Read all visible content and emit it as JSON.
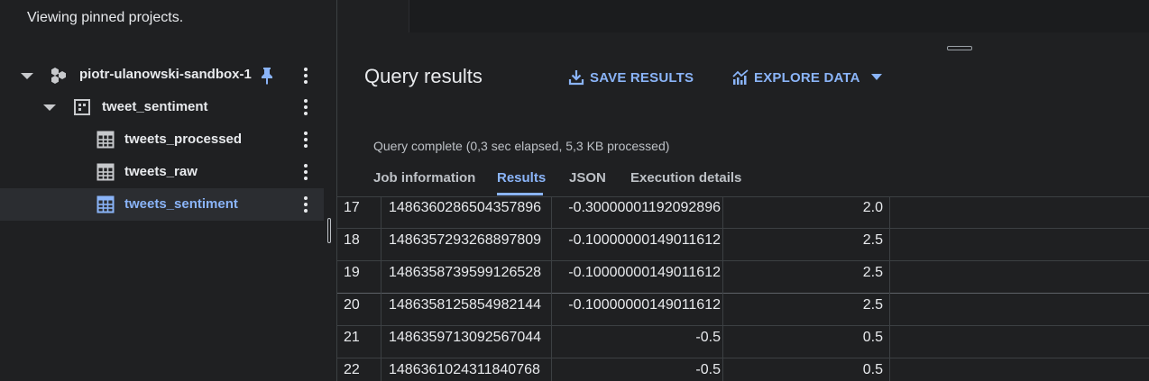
{
  "explorer": {
    "pinned_note": "Viewing pinned projects.",
    "project": {
      "label": "piotr-ulanowski-sandbox-1",
      "icon": "project-hexagons-icon",
      "pinned": true
    },
    "dataset": {
      "label": "tweet_sentiment",
      "icon": "dataset-icon"
    },
    "tables": [
      {
        "label": "tweets_processed",
        "icon": "table-icon",
        "selected": false
      },
      {
        "label": "tweets_raw",
        "icon": "table-icon",
        "selected": false
      },
      {
        "label": "tweets_sentiment",
        "icon": "table-icon",
        "selected": true
      }
    ]
  },
  "results": {
    "title": "Query results",
    "save_label": "SAVE RESULTS",
    "explore_label": "EXPLORE DATA",
    "status": "Query complete (0,3 sec elapsed, 5,3 KB processed)",
    "tabs": [
      {
        "label": "Job information",
        "active": false
      },
      {
        "label": "Results",
        "active": true
      },
      {
        "label": "JSON",
        "active": false
      },
      {
        "label": "Execution details",
        "active": false
      }
    ],
    "rows": [
      [
        "17",
        "1486360286504357896",
        "-0.30000001192092896",
        "2.0"
      ],
      [
        "18",
        "1486357293268897809",
        "-0.10000000149011612",
        "2.5"
      ],
      [
        "19",
        "1486358739599126528",
        "-0.10000000149011612",
        "2.5"
      ],
      [
        "20",
        "1486358125854982144",
        "-0.10000000149011612",
        "2.5"
      ],
      [
        "21",
        "1486359713092567044",
        "-0.5",
        "0.5"
      ],
      [
        "22",
        "1486361024311840768",
        "-0.5",
        "0.5"
      ]
    ]
  },
  "colors": {
    "accent": "#8ab4f8",
    "background": "#1f2022",
    "text": "#e8eaed"
  }
}
